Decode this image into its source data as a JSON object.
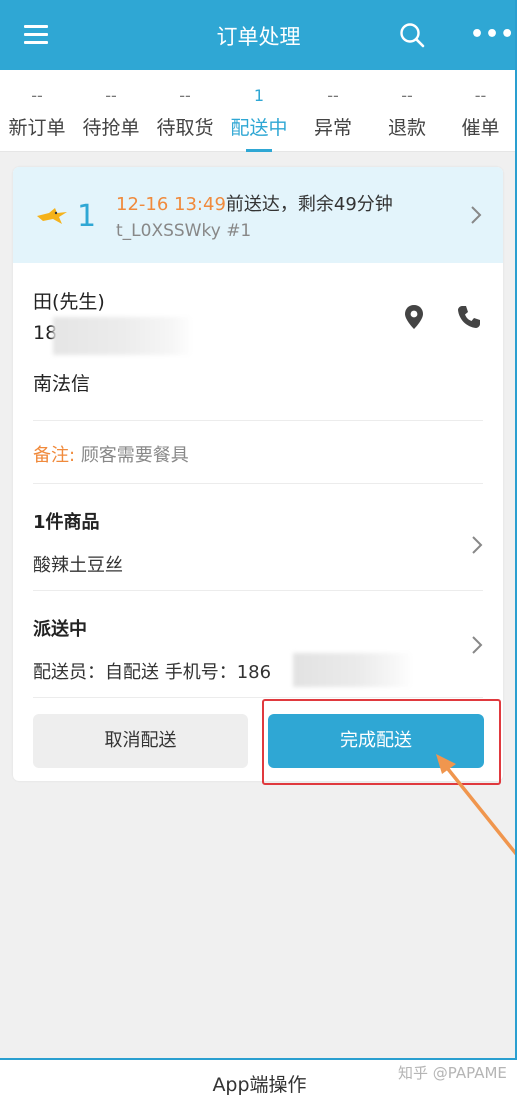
{
  "header": {
    "title": "订单处理",
    "menu_icon": "menu-icon",
    "search_icon": "search-icon",
    "more_icon": "more-icon"
  },
  "tabs": [
    {
      "count": "--",
      "label": "新订单",
      "active": false
    },
    {
      "count": "--",
      "label": "待抢单",
      "active": false
    },
    {
      "count": "--",
      "label": "待取货",
      "active": false
    },
    {
      "count": "1",
      "label": "配送中",
      "active": true
    },
    {
      "count": "--",
      "label": "异常",
      "active": false
    },
    {
      "count": "--",
      "label": "退款",
      "active": false
    },
    {
      "count": "--",
      "label": "催单",
      "active": false
    }
  ],
  "order": {
    "number": "1",
    "time": "12-16 13:49",
    "time_suffix": "前送达，剩余49分钟",
    "order_id": "t_L0XSSWky #1",
    "customer_name": "田(先生)",
    "customer_phone": "18",
    "address": "南法信",
    "remark_label": "备注:",
    "remark_value": "顾客需要餐具",
    "goods_title": "1件商品",
    "goods_item": "酸辣土豆丝",
    "status_title": "派送中",
    "courier_text": "配送员：自配送 手机号：186",
    "cancel_label": "取消配送",
    "complete_label": "完成配送"
  },
  "colors": {
    "accent": "#2fa7d4",
    "orange": "#f08a3c",
    "highlight_red": "#e0393e",
    "arrow": "#f0964e"
  },
  "caption": "App端操作",
  "watermark": "知乎 @PAPAME"
}
